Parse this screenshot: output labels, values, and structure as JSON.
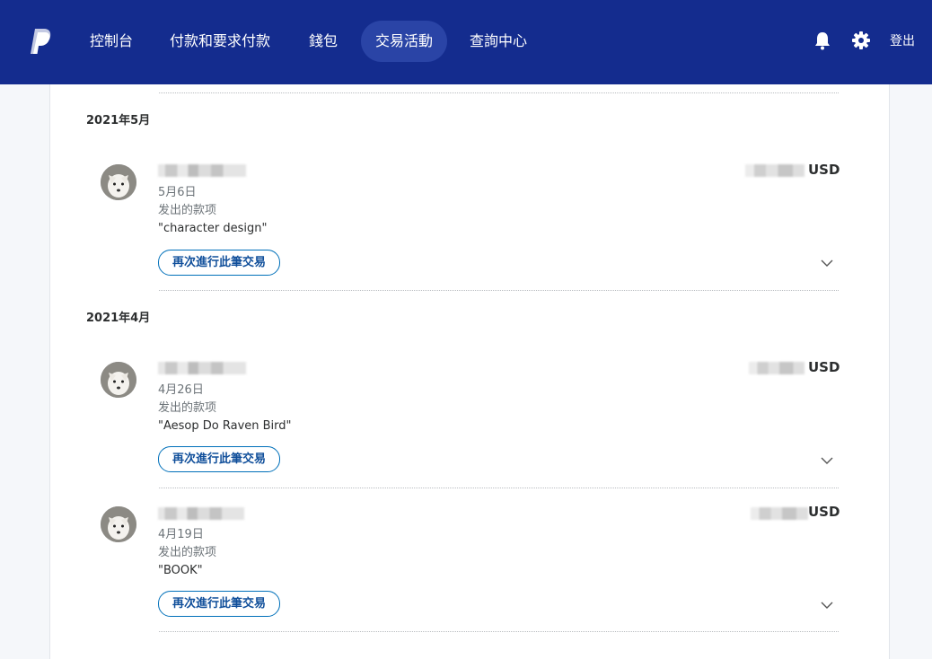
{
  "nav": {
    "items": [
      {
        "label": "控制台",
        "active": false
      },
      {
        "label": "付款和要求付款",
        "active": false
      },
      {
        "label": "錢包",
        "active": false
      },
      {
        "label": "交易活動",
        "active": true
      },
      {
        "label": "查詢中心",
        "active": false
      }
    ],
    "icons": [
      "paypal-logo",
      "bell-icon",
      "gear-icon"
    ],
    "logout_label": "登出"
  },
  "colors": {
    "nav_bg": "#142c8e",
    "nav_active": "#2a44a6",
    "button_border": "#0070ba"
  },
  "groups": [
    {
      "month": "2021年5月",
      "transactions": [
        {
          "currency": "USD",
          "date": "5月6日",
          "type": "发出的款项",
          "note": "\"character design\"",
          "button_label": "再次進行此筆交易"
        }
      ]
    },
    {
      "month": "2021年4月",
      "transactions": [
        {
          "currency": "USD",
          "date": "4月26日",
          "type": "发出的款项",
          "note": "\"Aesop Do Raven Bird\"",
          "button_label": "再次進行此筆交易"
        },
        {
          "currency": "USD",
          "date": "4月19日",
          "type": "发出的款项",
          "note": "\"BOOK\"",
          "button_label": "再次進行此筆交易"
        }
      ]
    }
  ]
}
